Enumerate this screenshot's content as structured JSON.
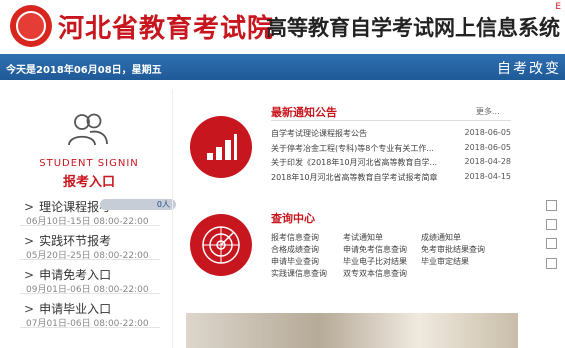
{
  "header": {
    "site_title": "河北省教育考试院",
    "system_title": "高等教育自学考试网上信息系统",
    "corner_link": "E"
  },
  "bar": {
    "date_text": "今天是2018年06月08日，星期五",
    "right_text": "自考改变"
  },
  "signin": {
    "en": "STUDENT SIGNIN",
    "zh": "报考入口"
  },
  "menu": [
    {
      "label": "理论课程报考",
      "date": "06月10日-15日 08:00-22:00",
      "badge": "0人"
    },
    {
      "label": "实践环节报考",
      "date": "05月20日-25日 08:00-22:00"
    },
    {
      "label": "申请免考入口",
      "date": "09月01日-06日 08:00-22:00"
    },
    {
      "label": "申请毕业入口",
      "date": "07月01日-06日 08:00-22:00"
    }
  ],
  "news": {
    "title": "最新通知公告",
    "more": "更多...",
    "items": [
      {
        "title": "自学考试理论课程报考公告",
        "date": "2018-06-05"
      },
      {
        "title": "关于停考冶金工程(专科)等8个专业有关工作...",
        "date": "2018-06-05"
      },
      {
        "title": "关于印发《2018年10月河北省高等教育自学...",
        "date": "2018-04-28"
      },
      {
        "title": "2018年10月河北省高等教育自学考试报考简章",
        "date": "2018-04-15"
      }
    ]
  },
  "query": {
    "title": "查询中心",
    "items": [
      "报考信息查询",
      "考试通知单",
      "成绩通知单",
      "合格成绩查询",
      "申请免考信息查询",
      "免考审批结果查询",
      "申请毕业查询",
      "毕业电子比对结果",
      "毕业审定结果",
      "实践课信息查询",
      "双专双本信息查询"
    ]
  },
  "colors": {
    "brand_red": "#c8161e",
    "bar_blue": "#2f6fb0"
  }
}
